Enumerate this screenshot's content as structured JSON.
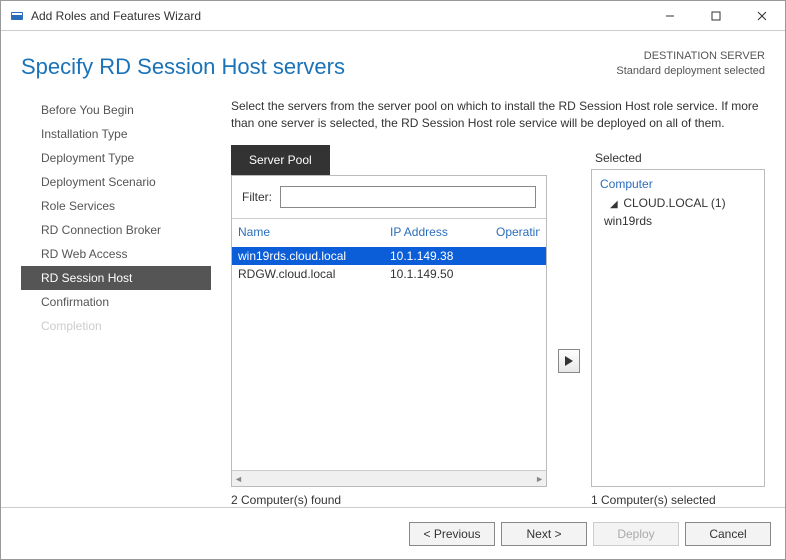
{
  "titlebar": {
    "title": "Add Roles and Features Wizard"
  },
  "page": {
    "title": "Specify RD Session Host servers",
    "dest_label": "DESTINATION SERVER",
    "dest_value": "Standard deployment selected"
  },
  "nav": [
    {
      "label": "Before You Begin",
      "state": "normal"
    },
    {
      "label": "Installation Type",
      "state": "normal"
    },
    {
      "label": "Deployment Type",
      "state": "normal"
    },
    {
      "label": "Deployment Scenario",
      "state": "normal"
    },
    {
      "label": "Role Services",
      "state": "normal"
    },
    {
      "label": "RD Connection Broker",
      "state": "normal"
    },
    {
      "label": "RD Web Access",
      "state": "normal"
    },
    {
      "label": "RD Session Host",
      "state": "active"
    },
    {
      "label": "Confirmation",
      "state": "normal"
    },
    {
      "label": "Completion",
      "state": "disabled"
    }
  ],
  "instructions": "Select the servers from the server pool on which to install the RD Session Host role service. If more than one server is selected, the RD Session Host role service will be deployed on all of them.",
  "pool": {
    "tab_label": "Server Pool",
    "filter_label": "Filter:",
    "filter_value": "",
    "columns": {
      "name": "Name",
      "ip": "IP Address",
      "os": "Operating"
    },
    "rows": [
      {
        "name": "win19rds.cloud.local",
        "ip": "10.1.149.38",
        "selected": true
      },
      {
        "name": "RDGW.cloud.local",
        "ip": "10.1.149.50",
        "selected": false
      }
    ],
    "count_label": "2 Computer(s) found"
  },
  "selected": {
    "label": "Selected",
    "header": "Computer",
    "group": "CLOUD.LOCAL (1)",
    "items": [
      "win19rds"
    ],
    "count_label": "1 Computer(s) selected"
  },
  "buttons": {
    "previous": "< Previous",
    "next": "Next >",
    "deploy": "Deploy",
    "cancel": "Cancel"
  }
}
